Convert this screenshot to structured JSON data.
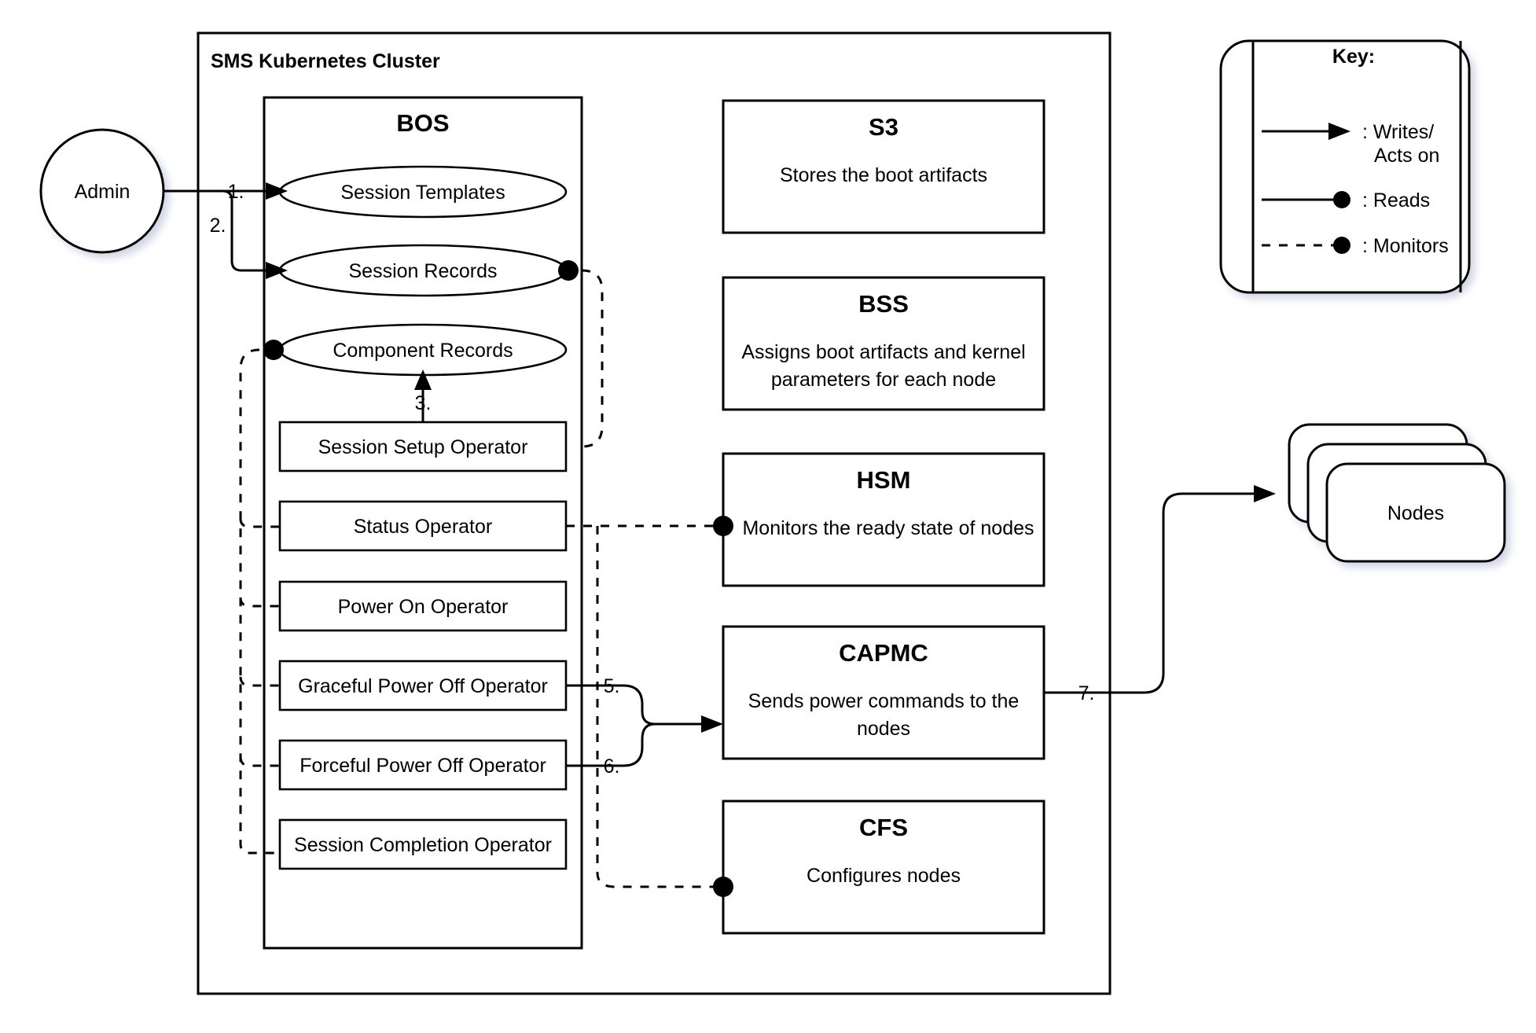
{
  "diagram": {
    "cluster": {
      "title": "SMS Kubernetes Cluster"
    },
    "actor": {
      "label": "Admin"
    },
    "bos": {
      "title": "BOS",
      "records": [
        {
          "label": "Session Templates"
        },
        {
          "label": "Session Records"
        },
        {
          "label": "Component Records"
        }
      ],
      "operators": [
        {
          "label": "Session Setup Operator"
        },
        {
          "label": "Status Operator"
        },
        {
          "label": "Power On Operator"
        },
        {
          "label": "Graceful Power Off Operator"
        },
        {
          "label": "Forceful Power  Off Operator"
        },
        {
          "label": "Session Completion Operator"
        }
      ]
    },
    "services": [
      {
        "title": "S3",
        "desc_line1": "Stores the boot artifacts",
        "desc_line2": ""
      },
      {
        "title": "BSS",
        "desc_line1": "Assigns boot artifacts and kernel",
        "desc_line2": "parameters for each node"
      },
      {
        "title": "HSM",
        "desc_line1": "Monitors the ready state of nodes",
        "desc_line2": ""
      },
      {
        "title": "CAPMC",
        "desc_line1": "Sends power commands to the",
        "desc_line2": "nodes"
      },
      {
        "title": "CFS",
        "desc_line1": "Configures nodes",
        "desc_line2": ""
      }
    ],
    "nodes": {
      "label": "Nodes"
    },
    "step_labels": {
      "s1": "1.",
      "s2": "2.",
      "s3": "3.",
      "s5": "5.",
      "s6": "6.",
      "s7": "7."
    },
    "key": {
      "title": "Key:",
      "entries": [
        {
          "label_line1": ": Writes/",
          "label_line2": "Acts on",
          "style": "arrow"
        },
        {
          "label_line1": ": Reads",
          "label_line2": "",
          "style": "dot-solid"
        },
        {
          "label_line1": ": Monitors",
          "label_line2": "",
          "style": "dot-dashed"
        }
      ]
    },
    "colors": {
      "stroke": "#000000",
      "fill": "#ffffff",
      "shadow": "#e8eaf2"
    }
  }
}
